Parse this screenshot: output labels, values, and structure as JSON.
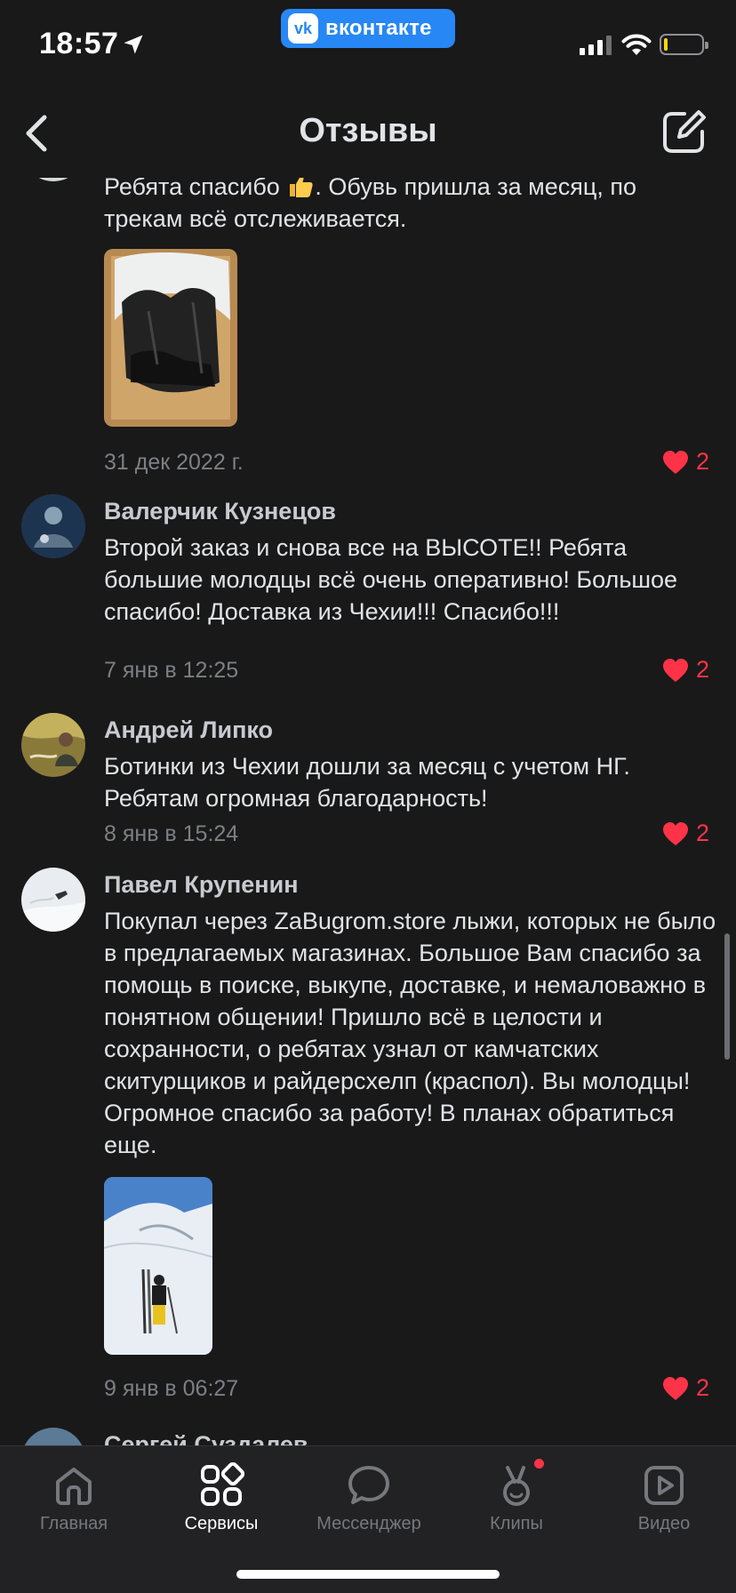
{
  "status_bar": {
    "time": "18:57",
    "vk_label": "вконтакте",
    "vk_logo_letters": "vk"
  },
  "header": {
    "title": "Отзывы"
  },
  "reviews": [
    {
      "text_before_emoji": "Ребята спасибо",
      "text_after_emoji": ". Обувь пришла за месяц, по трекам всё отслеживается.",
      "date": "31 дек 2022 г.",
      "likes": "2"
    },
    {
      "author": "Валерчик Кузнецов",
      "text": "Второй заказ и снова все на ВЫСОТЕ!! Ребята большие молодцы всё очень оперативно! Большое спасибо! Доставка из Чехии!!! Спасибо!!!",
      "date": "7 янв в 12:25",
      "likes": "2"
    },
    {
      "author": "Андрей Липко",
      "text": "Ботинки из Чехии дошли за месяц с учетом НГ. Ребятам огромная благодарность!",
      "date": "8 янв в 15:24",
      "likes": "2"
    },
    {
      "author": "Павел Крупенин",
      "text": "Покупал через ZaBugrom.store лыжи, которых не было в предлагаемых магазинах. Большое Вам спасибо за помощь в поиске, выкупе, доставке, и немаловажно в понятном общении! Пришло всё в целости и сохранности, о ребятах узнал от камчатских скитурщиков и райдерсхелп (краспол). Вы молодцы! Огромное спасибо за работу! В планах обратиться еще.",
      "date": "9 янв в 06:27",
      "likes": "2"
    },
    {
      "author": "Сергей Суздалев"
    }
  ],
  "tabbar": {
    "tabs": [
      {
        "label": "Главная",
        "icon": "home-icon",
        "active": false
      },
      {
        "label": "Сервисы",
        "icon": "services-icon",
        "active": true
      },
      {
        "label": "Мессенджер",
        "icon": "messenger-icon",
        "active": false
      },
      {
        "label": "Клипы",
        "icon": "clips-icon",
        "active": false,
        "badge": true
      },
      {
        "label": "Видео",
        "icon": "video-icon",
        "active": false
      }
    ]
  },
  "colors": {
    "background": "#19191a",
    "accent": "#2787f5",
    "like": "#ff3347",
    "secondary_text": "#7d7f84"
  }
}
